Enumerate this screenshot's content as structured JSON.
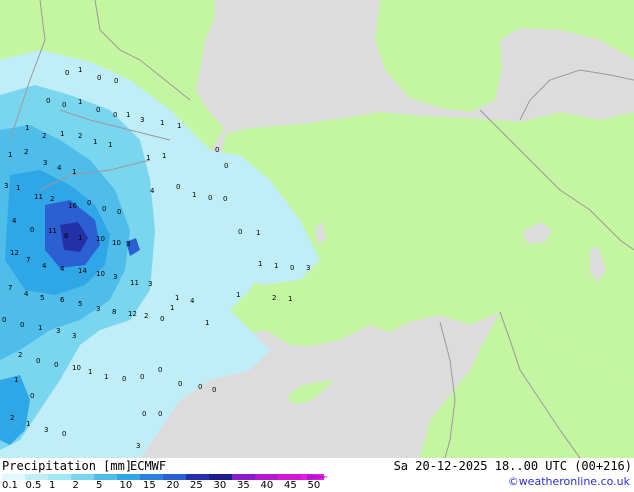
{
  "map": {
    "colors": {
      "sea": "#dcdcdc",
      "land": "#c4f5a0",
      "border": "#9a9a9a",
      "precip_light": "#bfeef8",
      "precip_mid": "#7ad5ef",
      "precip_blue": "#2fa6e6",
      "precip_dark": "#2c5fd1",
      "precip_deep": "#2430a8"
    },
    "values": [
      "0",
      "1",
      "0",
      "0",
      "0",
      "0",
      "1",
      "0",
      "0",
      "1",
      "3",
      "1",
      "1",
      "1",
      "2",
      "1",
      "2",
      "1",
      "1",
      "1",
      "2",
      "3",
      "4",
      "1",
      "1",
      "1",
      "0",
      "0",
      "3",
      "1",
      "11",
      "2",
      "16",
      "0",
      "0",
      "0",
      "4",
      "0",
      "11",
      "6",
      "1",
      "10",
      "10",
      "3",
      "12",
      "7",
      "4",
      "4",
      "14",
      "10",
      "3",
      "11",
      "3",
      "7",
      "4",
      "5",
      "6",
      "5",
      "3",
      "8",
      "12",
      "2",
      "0",
      "1",
      "1",
      "4",
      "1",
      "0",
      "0",
      "1",
      "3",
      "3",
      "4",
      "0",
      "1",
      "0",
      "0",
      "0",
      "1",
      "1",
      "1",
      "0",
      "3",
      "1",
      "2",
      "1",
      "2",
      "0",
      "0",
      "10",
      "1",
      "1",
      "0",
      "0",
      "0",
      "0",
      "0",
      "0",
      "2",
      "1",
      "3",
      "0",
      "0",
      "0",
      "3",
      "1",
      "0"
    ]
  },
  "legend": {
    "title": "Precipitation [mm]",
    "model": "ECMWF",
    "datetime": "Sa 20-12-2025 18..00 UTC (00+216)",
    "credit": "©weatheronline.co.uk",
    "ticks": [
      "0.1",
      "0.5",
      "1",
      "2",
      "5",
      "10",
      "15",
      "20",
      "25",
      "30",
      "35",
      "40",
      "45",
      "50"
    ],
    "colors": [
      "#e0f7fc",
      "#bdeff9",
      "#9fe6f6",
      "#7ad5ef",
      "#4fbde9",
      "#2fa6e6",
      "#2c7fdc",
      "#2c5fd1",
      "#2430a8",
      "#1f1c8c",
      "#8c1ac9",
      "#b41ac9",
      "#d21ad2",
      "#e61ae6"
    ]
  }
}
